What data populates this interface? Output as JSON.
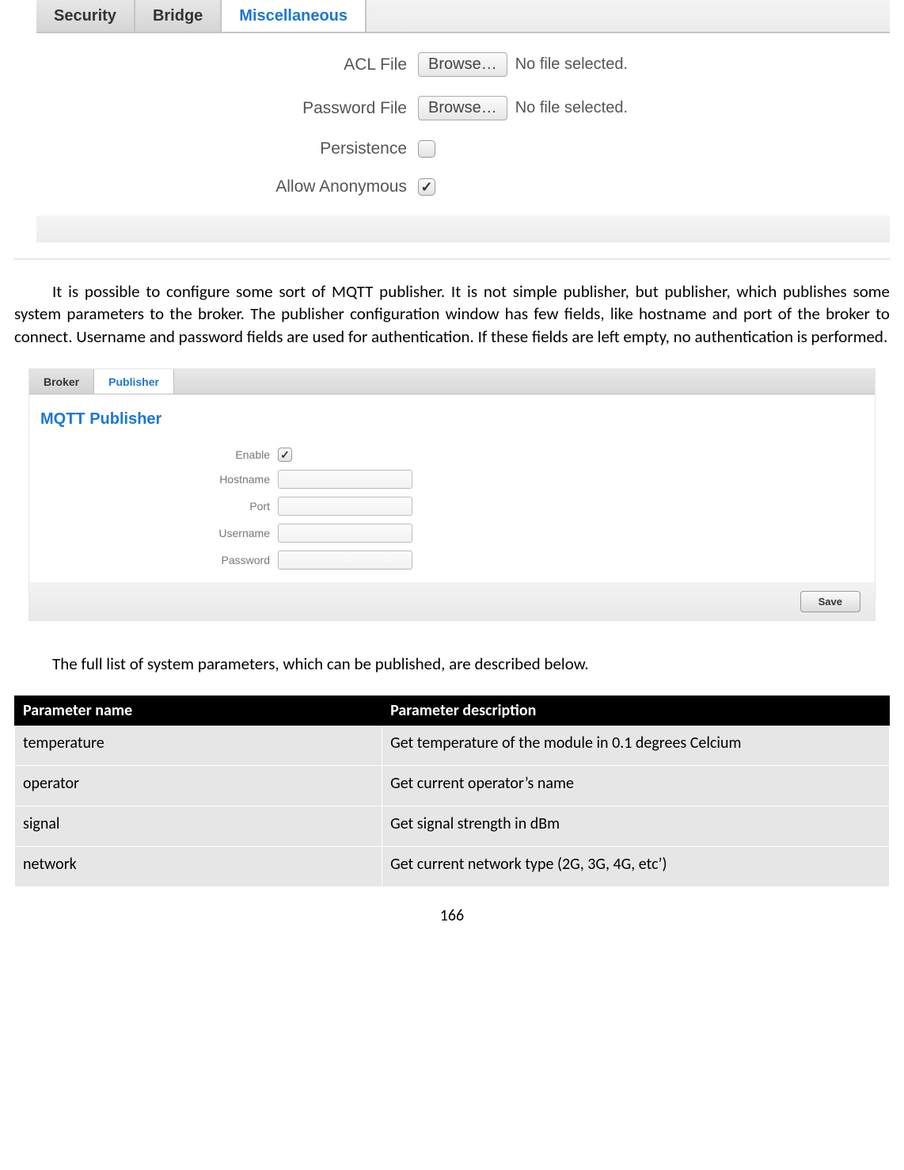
{
  "misc": {
    "tabs": [
      "Security",
      "Bridge",
      "Miscellaneous"
    ],
    "active_tab_index": 2,
    "fields": {
      "acl_label": "ACL File",
      "pwd_label": "Password File",
      "browse_label": "Browse…",
      "nofile_text": "No file selected.",
      "persistence_label": "Persistence",
      "persistence_checked": false,
      "anon_label": "Allow Anonymous",
      "anon_checked": true
    }
  },
  "para1": "It is possible to configure some sort of MQTT publisher. It is not simple publisher, but publisher, which publishes some system parameters to the broker. The publisher configuration window has few fields, like hostname and port of the broker to connect. Username and password fields are used for authentication. If these fields are left empty, no authentication is performed.",
  "publisher": {
    "tabs": [
      "Broker",
      "Publisher"
    ],
    "active_tab_index": 1,
    "title": "MQTT Publisher",
    "enable_label": "Enable",
    "enable_checked": true,
    "hostname_label": "Hostname",
    "hostname_value": "",
    "port_label": "Port",
    "port_value": "",
    "username_label": "Username",
    "username_value": "",
    "password_label": "Password",
    "password_value": "",
    "save_label": "Save"
  },
  "para2": "The full list of system parameters, which can be published, are described below.",
  "table": {
    "headers": [
      "Parameter name",
      "Parameter description"
    ],
    "rows": [
      [
        "temperature",
        "Get temperature of the module in 0.1 degrees Celcium"
      ],
      [
        "operator",
        "Get current operator’s name"
      ],
      [
        "signal",
        "Get signal strength in dBm"
      ],
      [
        "network",
        "Get current network type (2G, 3G, 4G, etc’)"
      ]
    ]
  },
  "page_number": "166"
}
